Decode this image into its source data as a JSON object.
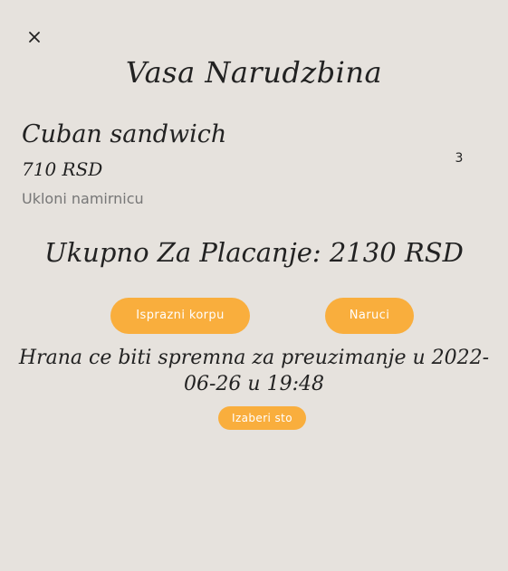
{
  "modal": {
    "title": "Vasa Narudzbina"
  },
  "cart": {
    "items": [
      {
        "name": "Cuban sandwich",
        "price": "710 RSD",
        "remove_label": "Ukloni namirnicu",
        "quantity": "3"
      }
    ],
    "total": "Ukupno Za Placanje: 2130 RSD"
  },
  "actions": {
    "empty_cart_label": "Isprazni korpu",
    "order_label": "Naruci"
  },
  "pickup": {
    "message": "Hrana ce biti spremna za preuzimanje u 2022-06-26 u 19:48",
    "choose_table_label": "Izaberi sto"
  },
  "colors": {
    "background": "#e6e2dd",
    "accent": "#f9ae3d",
    "text": "#222222",
    "muted_text": "#777777"
  },
  "icons": {
    "close": "close-icon"
  }
}
